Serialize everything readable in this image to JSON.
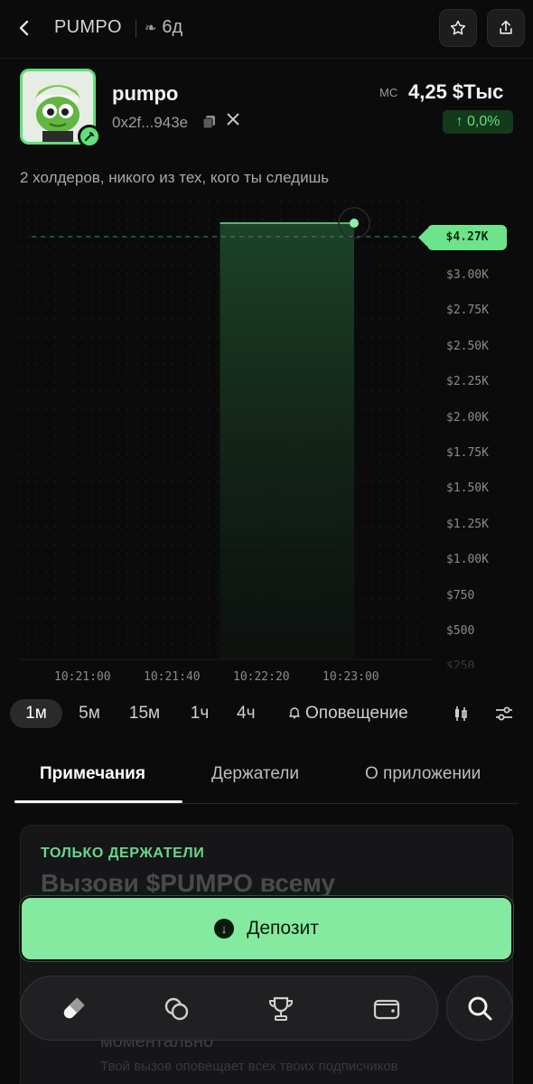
{
  "header": {
    "ticker": "PUMPO",
    "age": "6д",
    "icons": {
      "back": "chevron-left-icon",
      "age": "sprout-icon",
      "star": "star-icon",
      "share": "share-icon"
    }
  },
  "token": {
    "name": "pumpo",
    "address": "0x2f...943e",
    "mc_label": "MC",
    "mc_value": "4,25 $Тыс",
    "change": "↑ 0,0%",
    "icons": {
      "copy": "copy-icon",
      "social": "x-icon",
      "badge": "pen-icon"
    }
  },
  "holders_text": "2 холдеров, никого из тех, кого ты следишь",
  "chart_data": {
    "type": "line",
    "x": [
      "10:21:00",
      "10:21:40",
      "10:22:20",
      "10:23:00"
    ],
    "y_ticks": [
      "$3.00K",
      "$2.75K",
      "$2.50K",
      "$2.25K",
      "$2.00K",
      "$1.75K",
      "$1.50K",
      "$1.25K",
      "$1.00K",
      "$750",
      "$500",
      "$250"
    ],
    "current_price_label": "$4.27K",
    "series": [
      {
        "values": [
          {
            "x": "10:22:00",
            "y": 0
          },
          {
            "x": "10:22:00",
            "y": 4270
          },
          {
            "x": "10:23:00",
            "y": 4270
          }
        ]
      }
    ],
    "grid": true,
    "colors": {
      "line": "#6ee48a",
      "area": "#1a3a23"
    }
  },
  "timeframes": [
    "1м",
    "5м",
    "15м",
    "1ч",
    "4ч"
  ],
  "active_timeframe": "1м",
  "alert_label": "Оповещение",
  "tools": {
    "candles": "candlestick-icon",
    "settings": "sliders-icon",
    "alert": "bell-icon"
  },
  "tabs": [
    "Примечания",
    "Держатели",
    "О приложении"
  ],
  "active_tab": "Примечания",
  "card": {
    "kicker": "ТОЛЬКО ДЕРЖАТЕЛИ",
    "title": "Вызови $PUMPO всему",
    "subtitle": "моментально",
    "body": "Твой вызов оповещает всех твоих подписчиков"
  },
  "deposit_label": "Депозит",
  "nav": {
    "items": [
      "pill-icon",
      "coins-icon",
      "trophy-icon",
      "wallet-icon"
    ],
    "search": "search-icon"
  },
  "colors": {
    "accent": "#6ee48a",
    "background": "#0b0b0c"
  }
}
